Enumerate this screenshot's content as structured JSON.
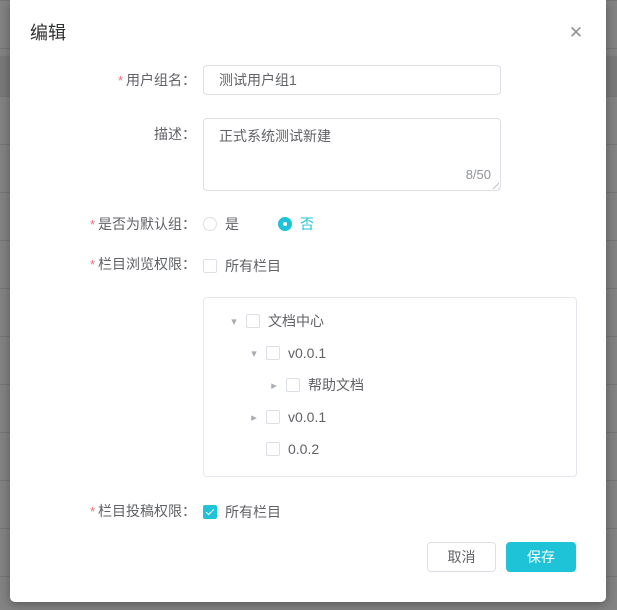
{
  "dialog": {
    "title": "编辑",
    "close_glyph": "✕"
  },
  "misc": {
    "required_glyph": "*"
  },
  "form": {
    "group_name": {
      "label": "用户组名：",
      "required": true,
      "value": "测试用户组1"
    },
    "description": {
      "label": "描述：",
      "required": false,
      "value": "正式系统测试新建",
      "counter": "8/50"
    },
    "default_group": {
      "label": "是否为默认组：",
      "required": true,
      "options": [
        {
          "label": "是",
          "selected": false
        },
        {
          "label": "否",
          "selected": true
        }
      ]
    },
    "browse_permission": {
      "label": "栏目浏览权限：",
      "required": true,
      "checkbox_label": "所有栏目",
      "checked": false
    },
    "post_permission": {
      "label": "栏目投稿权限：",
      "required": true,
      "checkbox_label": "所有栏目",
      "checked": true
    }
  },
  "tree": {
    "nodes": [
      {
        "label": "文档中心",
        "level": 0,
        "expand": "expanded"
      },
      {
        "label": "v0.0.1",
        "level": 1,
        "expand": "expanded"
      },
      {
        "label": "帮助文档",
        "level": 2,
        "expand": "collapsed"
      },
      {
        "label": "v0.0.1",
        "level": 1,
        "expand": "collapsed"
      },
      {
        "label": "0.0.2",
        "level": 1,
        "expand": "leaf"
      }
    ]
  },
  "footer": {
    "cancel_label": "取消",
    "save_label": "保存"
  },
  "colors": {
    "accent": "#1EC3D8",
    "required_mark": "#F56C6C"
  }
}
